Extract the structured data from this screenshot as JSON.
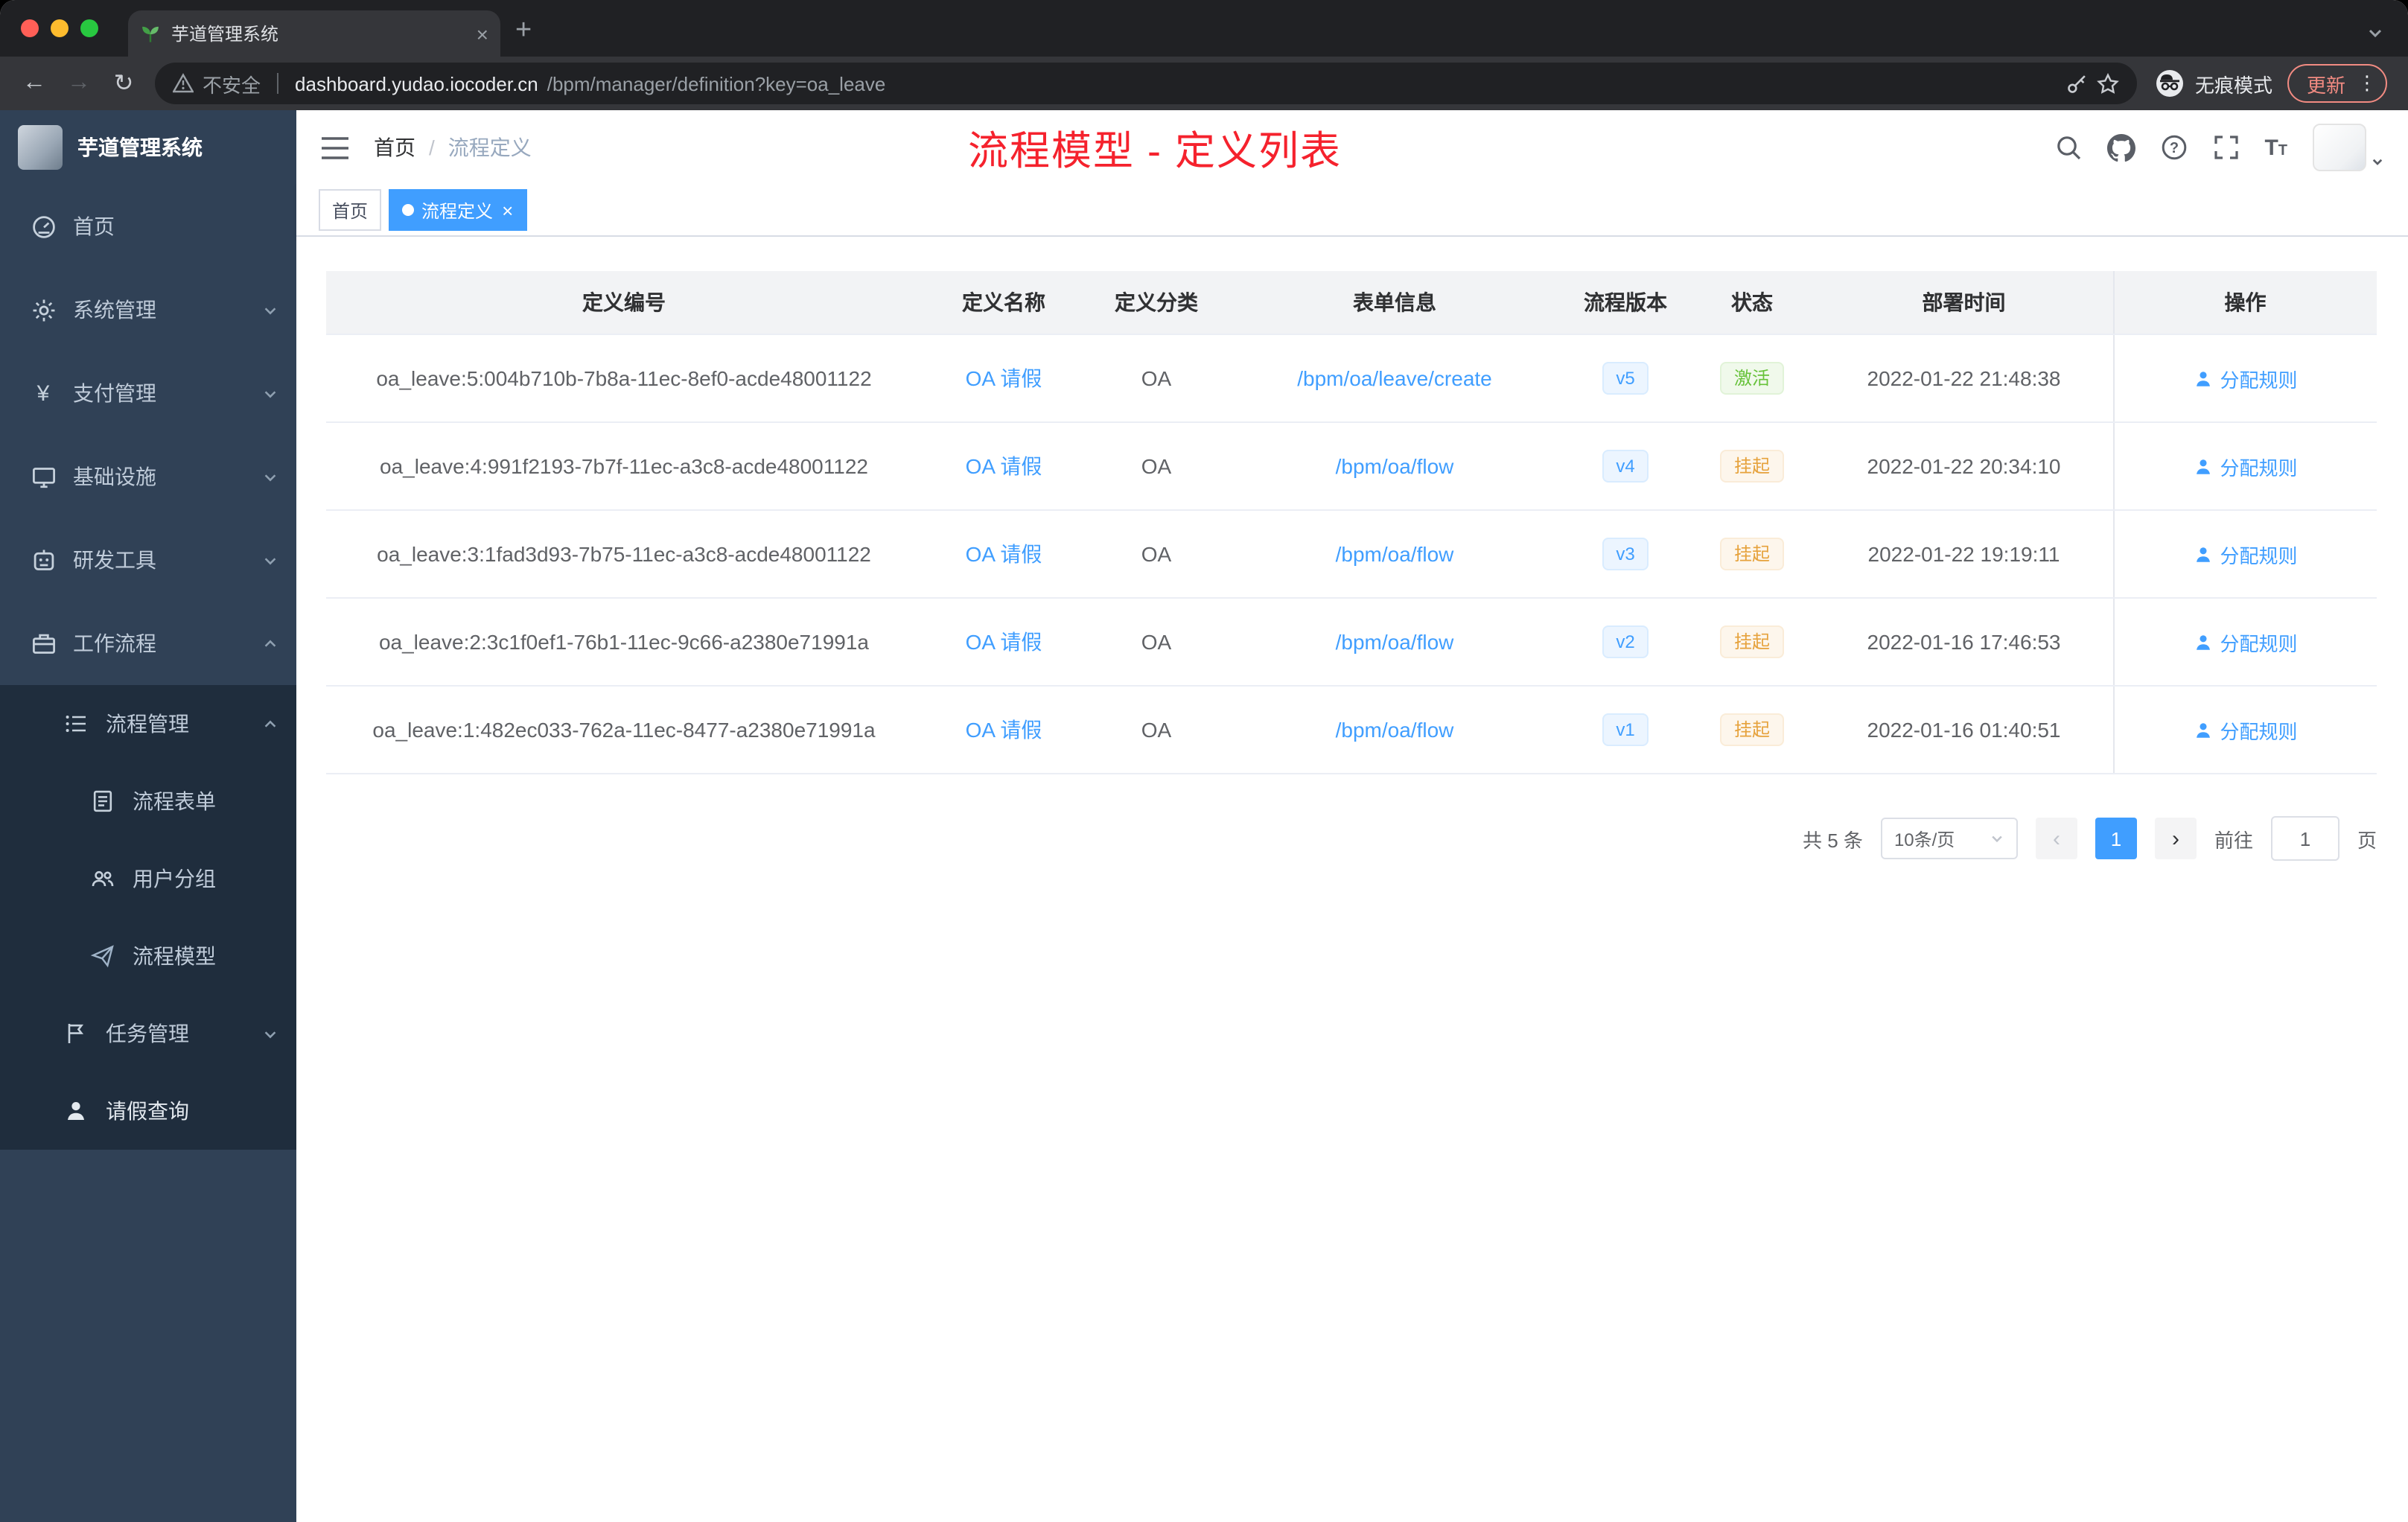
{
  "colors": {
    "accent": "#409eff",
    "success": "#67c23a",
    "warning": "#e6a23c",
    "title_red": "#f5222d",
    "sidebar_bg": "#304156",
    "submenu_bg": "#1f2d3d"
  },
  "browser": {
    "tab_title": "芋道管理系统",
    "security_label": "不安全",
    "url_host": "dashboard.yudao.iocoder.cn",
    "url_path": "/bpm/manager/definition?key=oa_leave",
    "incognito_label": "无痕模式",
    "update_label": "更新"
  },
  "sidebar": {
    "logo_title": "芋道管理系统",
    "menu": {
      "home": "首页",
      "system": "系统管理",
      "payment": "支付管理",
      "infra": "基础设施",
      "devtools": "研发工具",
      "workflow": "工作流程",
      "process_mgmt": "流程管理",
      "process_form": "流程表单",
      "user_group": "用户分组",
      "process_model": "流程模型",
      "task_mgmt": "任务管理",
      "leave_query": "请假查询"
    }
  },
  "navbar": {
    "breadcrumb_home": "首页",
    "breadcrumb_sep": "/",
    "breadcrumb_current": "流程定义",
    "overlay_title": "流程模型 - 定义列表"
  },
  "tags": {
    "home": "首页",
    "active": "流程定义",
    "close": "×"
  },
  "table": {
    "columns": [
      "定义编号",
      "定义名称",
      "定义分类",
      "表单信息",
      "流程版本",
      "状态",
      "部署时间",
      "操作"
    ],
    "rows": [
      {
        "id": "oa_leave:5:004b710b-7b8a-11ec-8ef0-acde48001122",
        "name": "OA 请假",
        "category": "OA",
        "form": "/bpm/oa/leave/create",
        "version": "v5",
        "status": "激活",
        "deploy_time": "2022-01-22 21:48:38",
        "action": "分配规则"
      },
      {
        "id": "oa_leave:4:991f2193-7b7f-11ec-a3c8-acde48001122",
        "name": "OA 请假",
        "category": "OA",
        "form": "/bpm/oa/flow",
        "version": "v4",
        "status": "挂起",
        "deploy_time": "2022-01-22 20:34:10",
        "action": "分配规则"
      },
      {
        "id": "oa_leave:3:1fad3d93-7b75-11ec-a3c8-acde48001122",
        "name": "OA 请假",
        "category": "OA",
        "form": "/bpm/oa/flow",
        "version": "v3",
        "status": "挂起",
        "deploy_time": "2022-01-22 19:19:11",
        "action": "分配规则"
      },
      {
        "id": "oa_leave:2:3c1f0ef1-76b1-11ec-9c66-a2380e71991a",
        "name": "OA 请假",
        "category": "OA",
        "form": "/bpm/oa/flow",
        "version": "v2",
        "status": "挂起",
        "deploy_time": "2022-01-16 17:46:53",
        "action": "分配规则"
      },
      {
        "id": "oa_leave:1:482ec033-762a-11ec-8477-a2380e71991a",
        "name": "OA 请假",
        "category": "OA",
        "form": "/bpm/oa/flow",
        "version": "v1",
        "status": "挂起",
        "deploy_time": "2022-01-16 01:40:51",
        "action": "分配规则"
      }
    ]
  },
  "pagination": {
    "total": "共 5 条",
    "page_size": "10条/页",
    "prev": "‹",
    "current_page": "1",
    "next": "›",
    "goto_label": "前往",
    "goto_value": "1",
    "unit_label": "页"
  }
}
